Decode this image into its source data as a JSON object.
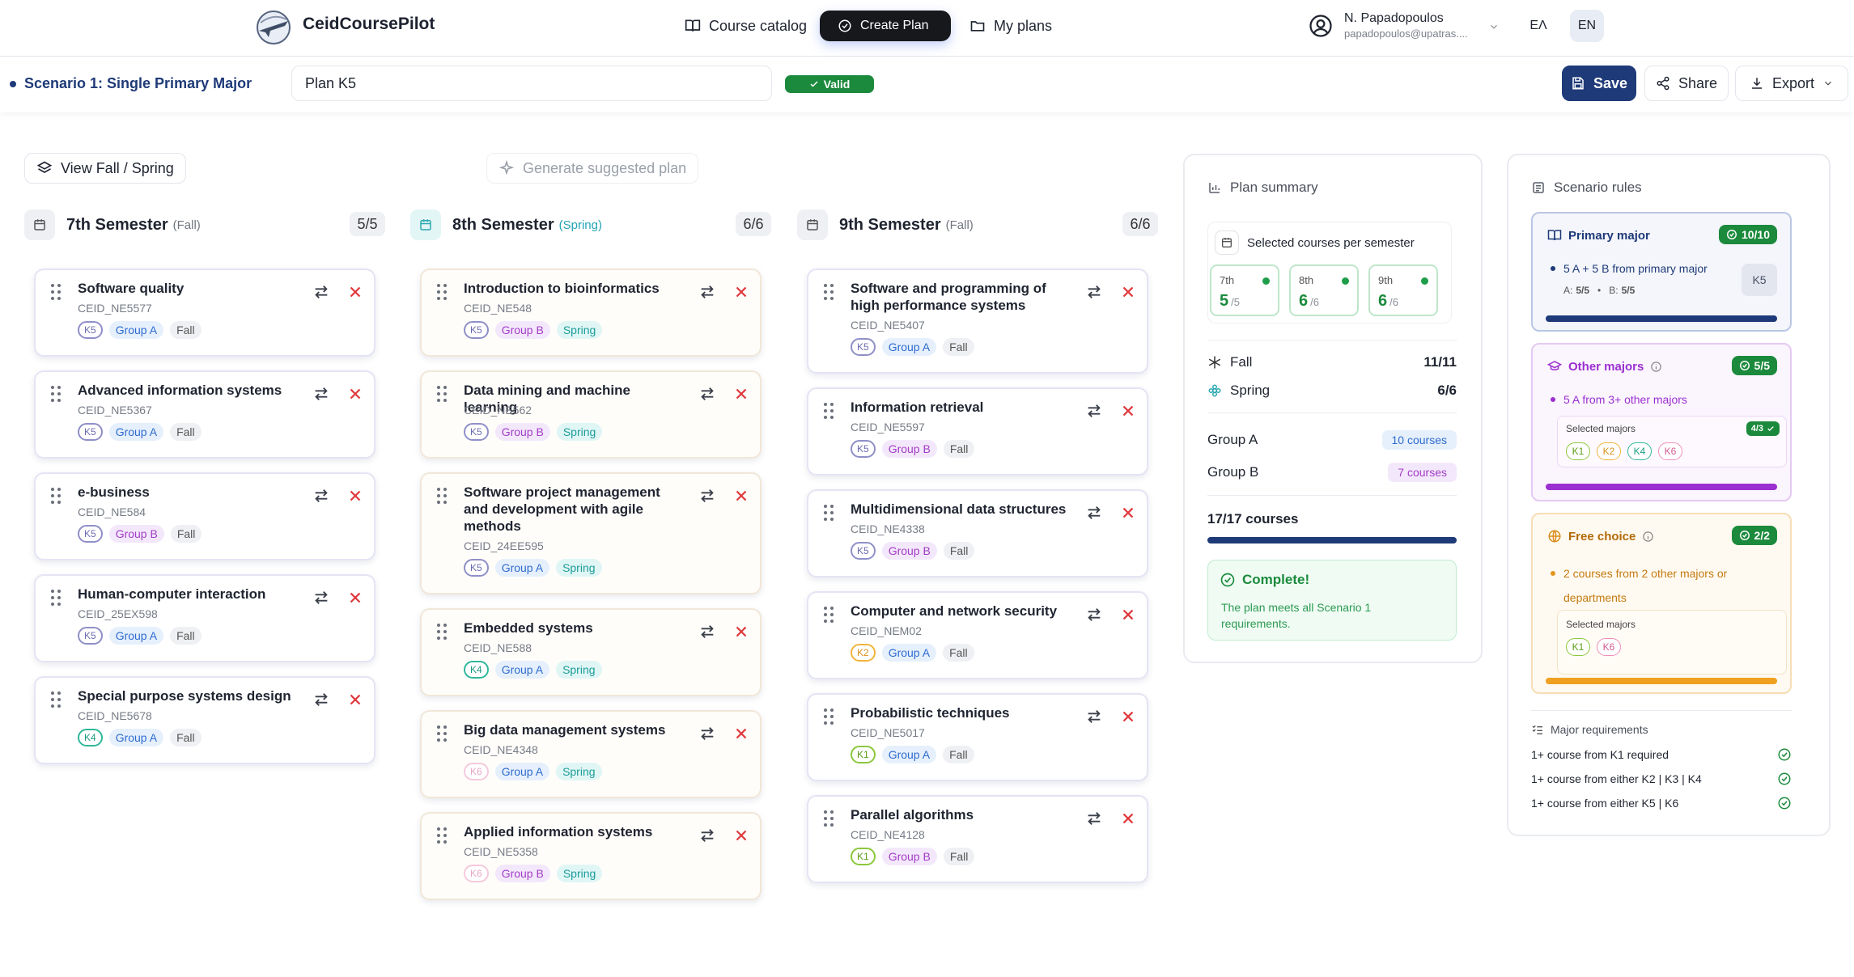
{
  "app": {
    "brand": "CeidCoursePilot"
  },
  "nav": {
    "catalog": "Course catalog",
    "create": "Create Plan",
    "plans": "My plans"
  },
  "user": {
    "name": "N. Papadopoulos",
    "email": "papadopoulos@upatras...."
  },
  "lang": {
    "el": "ΕΛ",
    "en": "EN"
  },
  "plan": {
    "scenario": "Scenario 1: Single Primary Major",
    "name": "Plan K5",
    "status": "Valid",
    "save": "Save",
    "share": "Share",
    "export": "Export"
  },
  "toolbar": {
    "view": "View Fall / Spring",
    "generate": "Generate suggested plan"
  },
  "semesters": [
    {
      "title": "7th Semester",
      "term": "(Fall)",
      "count": "5/5",
      "courses": [
        {
          "title": "Software quality",
          "code": "CEID_NE5577",
          "major": "K5",
          "group": "Group A",
          "term": "Fall"
        },
        {
          "title": "Advanced information systems",
          "code": "CEID_NE5367",
          "major": "K5",
          "group": "Group A",
          "term": "Fall"
        },
        {
          "title": "e-business",
          "code": "CEID_NE584",
          "major": "K5",
          "group": "Group B",
          "term": "Fall"
        },
        {
          "title": "Human-computer interaction",
          "code": "CEID_25EX598",
          "major": "K5",
          "group": "Group A",
          "term": "Fall"
        },
        {
          "title": "Special purpose systems design",
          "code": "CEID_NE5678",
          "major": "K4",
          "group": "Group A",
          "term": "Fall"
        }
      ]
    },
    {
      "title": "8th Semester",
      "term": "(Spring)",
      "count": "6/6",
      "courses": [
        {
          "title": "Introduction to bioinformatics",
          "code": "CEID_NE548",
          "major": "K5",
          "group": "Group B",
          "term": "Spring"
        },
        {
          "title": "Data mining and machine learning",
          "code": "CEID_NE562",
          "major": "K5",
          "group": "Group B",
          "term": "Spring"
        },
        {
          "title": "Software project management and development with agile methods",
          "code": "CEID_24EE595",
          "major": "K5",
          "group": "Group A",
          "term": "Spring"
        },
        {
          "title": "Embedded systems",
          "code": "CEID_NE588",
          "major": "K4",
          "group": "Group A",
          "term": "Spring"
        },
        {
          "title": "Big data management systems",
          "code": "CEID_NE4348",
          "major": "K6",
          "group": "Group A",
          "term": "Spring"
        },
        {
          "title": "Applied information systems",
          "code": "CEID_NE5358",
          "major": "K6",
          "group": "Group B",
          "term": "Spring"
        }
      ]
    },
    {
      "title": "9th Semester",
      "term": "(Fall)",
      "count": "6/6",
      "courses": [
        {
          "title": "Software and programming of high performance systems",
          "code": "CEID_NE5407",
          "major": "K5",
          "group": "Group A",
          "term": "Fall"
        },
        {
          "title": "Information retrieval",
          "code": "CEID_NE5597",
          "major": "K5",
          "group": "Group B",
          "term": "Fall"
        },
        {
          "title": "Multidimensional data structures",
          "code": "CEID_NE4338",
          "major": "K5",
          "group": "Group B",
          "term": "Fall"
        },
        {
          "title": "Computer and network security",
          "code": "CEID_NEM02",
          "major": "K2",
          "group": "Group A",
          "term": "Fall"
        },
        {
          "title": "Probabilistic techniques",
          "code": "CEID_NE5017",
          "major": "K1",
          "group": "Group A",
          "term": "Fall"
        },
        {
          "title": "Parallel algorithms",
          "code": "CEID_NE4128",
          "major": "K1",
          "group": "Group B",
          "term": "Fall"
        }
      ]
    }
  ],
  "summary": {
    "title": "Plan summary",
    "per_semester_label": "Selected courses per semester",
    "per_semester": [
      {
        "label": "7th",
        "value": "5",
        "max": "/5"
      },
      {
        "label": "8th",
        "value": "6",
        "max": "/6"
      },
      {
        "label": "9th",
        "value": "6",
        "max": "/6"
      }
    ],
    "fall_label": "Fall",
    "fall_value": "11/11",
    "spring_label": "Spring",
    "spring_value": "6/6",
    "group_a_label": "Group A",
    "group_a_value": "10 courses",
    "group_b_label": "Group B",
    "group_b_value": "7 courses",
    "total": "17/17 courses",
    "progress": 1.0,
    "complete_title": "Complete!",
    "complete_text": "The plan meets all Scenario 1 requirements."
  },
  "rules": {
    "title": "Scenario rules",
    "primary": {
      "title": "Primary major",
      "badge": "10/10",
      "text": "5 A + 5 B from primary major",
      "a_label": "A:",
      "a_value": "5/5",
      "b_label": "B:",
      "b_value": "5/5",
      "chip": "K5",
      "progress": 1.0
    },
    "other": {
      "title": "Other majors",
      "badge": "5/5",
      "text": "5 A from 3+ other majors",
      "selected_label": "Selected majors",
      "selected_badge": "4/3",
      "chips": [
        "K1",
        "K2",
        "K4",
        "K6"
      ],
      "progress": 1.0
    },
    "free": {
      "title": "Free choice",
      "badge": "2/2",
      "text": "2 courses from 2 other majors or departments",
      "selected_label": "Selected majors",
      "chips": [
        "K1",
        "K6"
      ],
      "progress": 1.0
    },
    "major_req_title": "Major requirements",
    "requirements": [
      "1+ course from K1 required",
      "1+ course from either K2 | K3 | K4",
      "1+ course from either K5 | K6"
    ]
  },
  "colors": {
    "accent": "#1e3a78",
    "success": "#1b8a3c",
    "purple": "#9b2fd0",
    "orange": "#f0a020"
  }
}
